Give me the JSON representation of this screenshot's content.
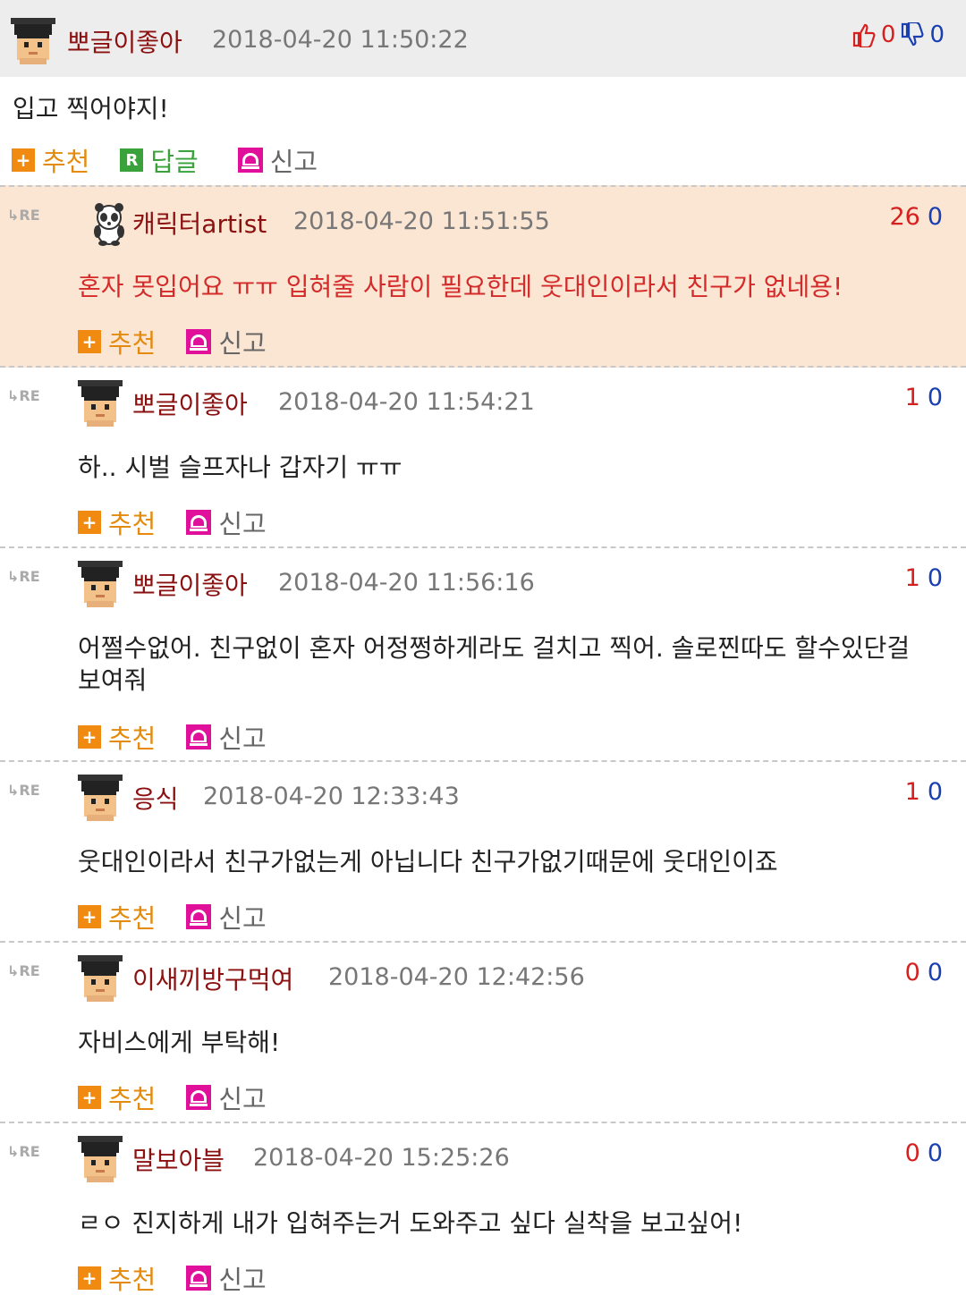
{
  "main_comment": {
    "nickname": "뽀글이좋아",
    "date": "2018-04-20 11:50:22",
    "likes": "0",
    "dislikes": "0",
    "body": "입고 찍어야지!",
    "actions": {
      "recommend": "추천",
      "reply": "답글",
      "report": "신고"
    }
  },
  "replies": [
    {
      "nickname": "캐릭터artist",
      "date": "2018-04-20 11:51:55",
      "up": "26",
      "down": "0",
      "body": "혼자 못입어요 ㅠㅠ 입혀줄 사람이 필요한데 웃대인이라서 친구가 없네용!",
      "avatar": "panda-avatar",
      "highlighted": true
    },
    {
      "nickname": "뽀글이좋아",
      "date": "2018-04-20 11:54:21",
      "up": "1",
      "down": "0",
      "body": "하.. 시벌 슬프자나 갑자기 ㅠㅠ",
      "avatar": "pixel-avatar"
    },
    {
      "nickname": "뽀글이좋아",
      "date": "2018-04-20 11:56:16",
      "up": "1",
      "down": "0",
      "body": "어쩔수없어. 친구없이 혼자 어정쩡하게라도 걸치고 찍어. 솔로찐따도 할수있단걸 보여줘",
      "avatar": "pixel-avatar"
    },
    {
      "nickname": "응식",
      "date": "2018-04-20 12:33:43",
      "up": "1",
      "down": "0",
      "body": "웃대인이라서 친구가없는게 아닙니다 친구가없기때문에 웃대인이죠",
      "avatar": "pixel-avatar"
    },
    {
      "nickname": "이새끼방구먹여",
      "date": "2018-04-20 12:42:56",
      "up": "0",
      "down": "0",
      "body": "자비스에게 부탁해!",
      "avatar": "pixel-avatar"
    },
    {
      "nickname": "말보아블",
      "date": "2018-04-20 15:25:26",
      "up": "0",
      "down": "0",
      "body": "ㄹㅇ 진지하게 내가 입혀주는거 도와주고 싶다 실착을 보고싶어!",
      "avatar": "pixel-avatar"
    }
  ],
  "labels": {
    "re": "RE",
    "recommend": "추천",
    "report": "신고",
    "reply_icon_letter": "R",
    "plus_icon": "+"
  },
  "colors": {
    "nickname": "#8b1010",
    "recommend": "#e48a0c",
    "reply": "#3aa23a",
    "report_icon": "#e0109a",
    "like": "#d62020",
    "dislike": "#1a3fb0",
    "highlight_bg": "#fbe5d3"
  }
}
